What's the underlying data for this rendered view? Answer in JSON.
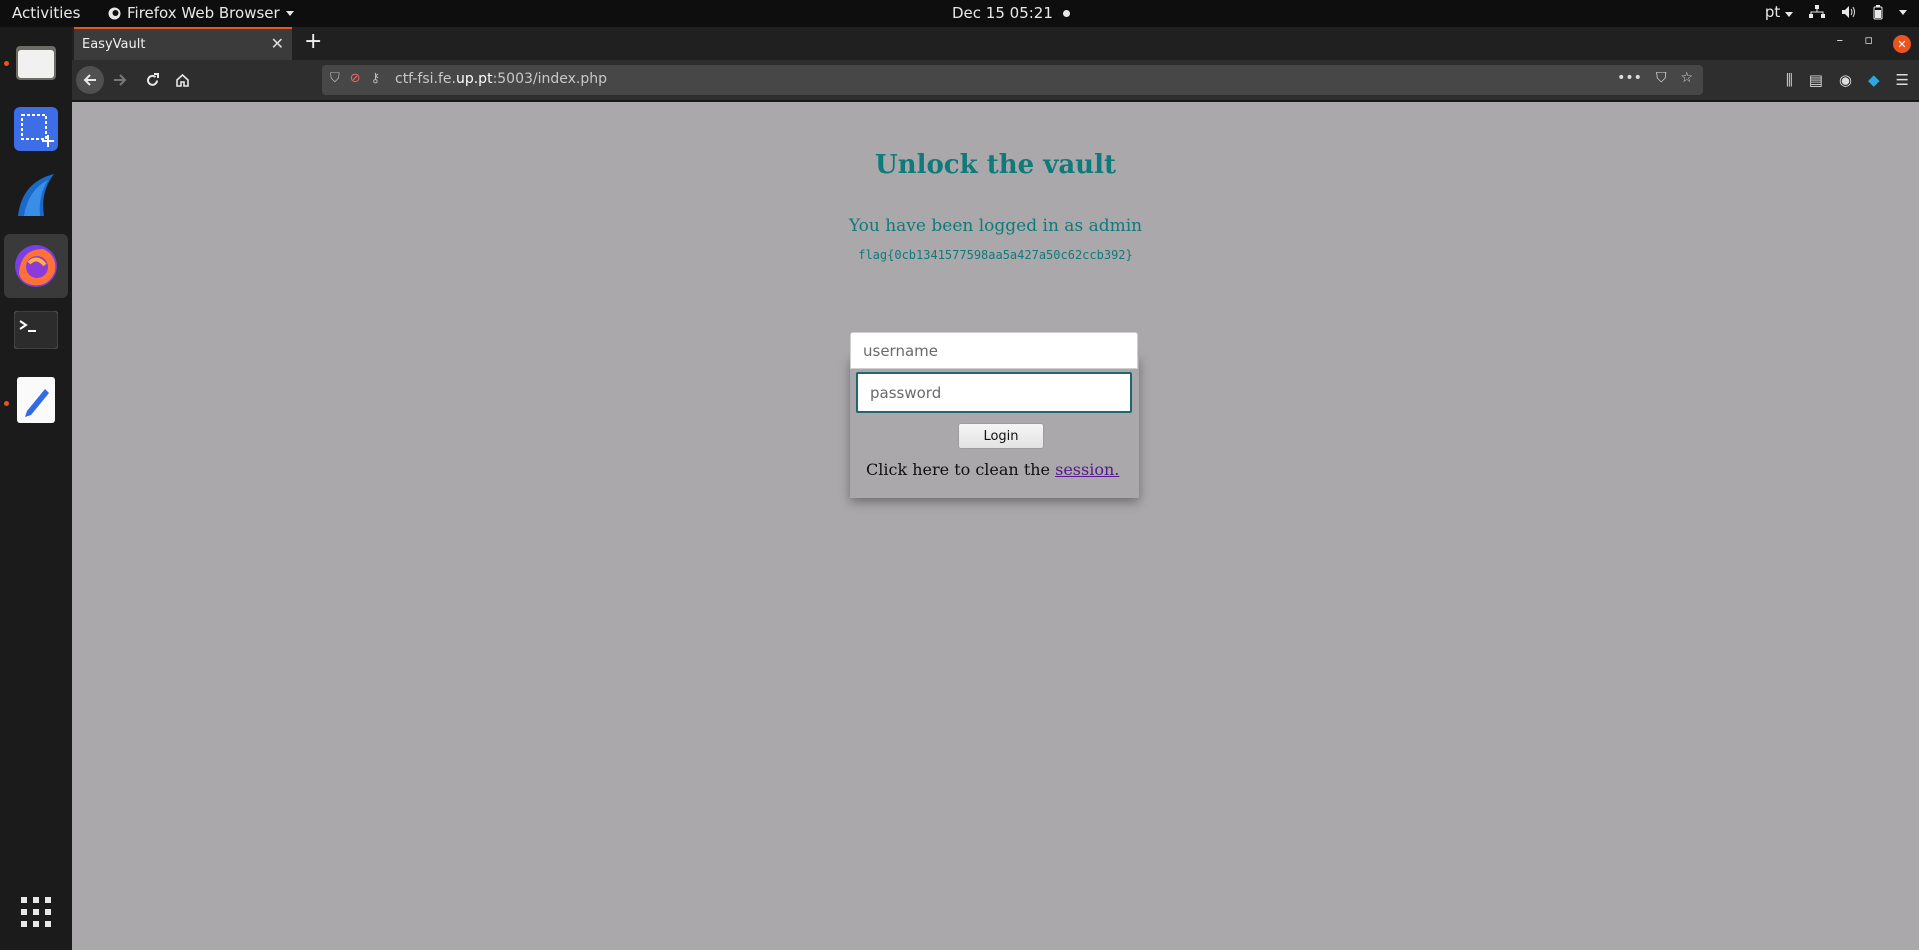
{
  "topbar": {
    "activities": "Activities",
    "app_name": "Firefox Web Browser",
    "clock": "Dec 15  05:21",
    "keyboard_layout": "pt"
  },
  "dock": {
    "items": [
      "files-icon",
      "screenshot-icon",
      "wireshark-icon",
      "firefox-icon",
      "terminal-icon",
      "text-editor-icon",
      "app-grid-icon"
    ]
  },
  "browser": {
    "tab_title": "EasyVault",
    "url_prefix": "ctf-fsi.fe.",
    "url_host": "up.pt",
    "url_suffix": ":5003/index.php"
  },
  "page": {
    "heading": "Unlock the vault",
    "logged_message": "You have been logged in as admin",
    "flag": "flag{0cb1341577598aa5a427a50c62ccb392}",
    "username_placeholder": "username",
    "password_placeholder": "password",
    "login_label": "Login",
    "clean_text": "Click here to clean the ",
    "clean_link": "session."
  },
  "colors": {
    "accent": "#e95420",
    "page_bg": "#aaa8aa",
    "teal_text": "#0f7a7a"
  }
}
